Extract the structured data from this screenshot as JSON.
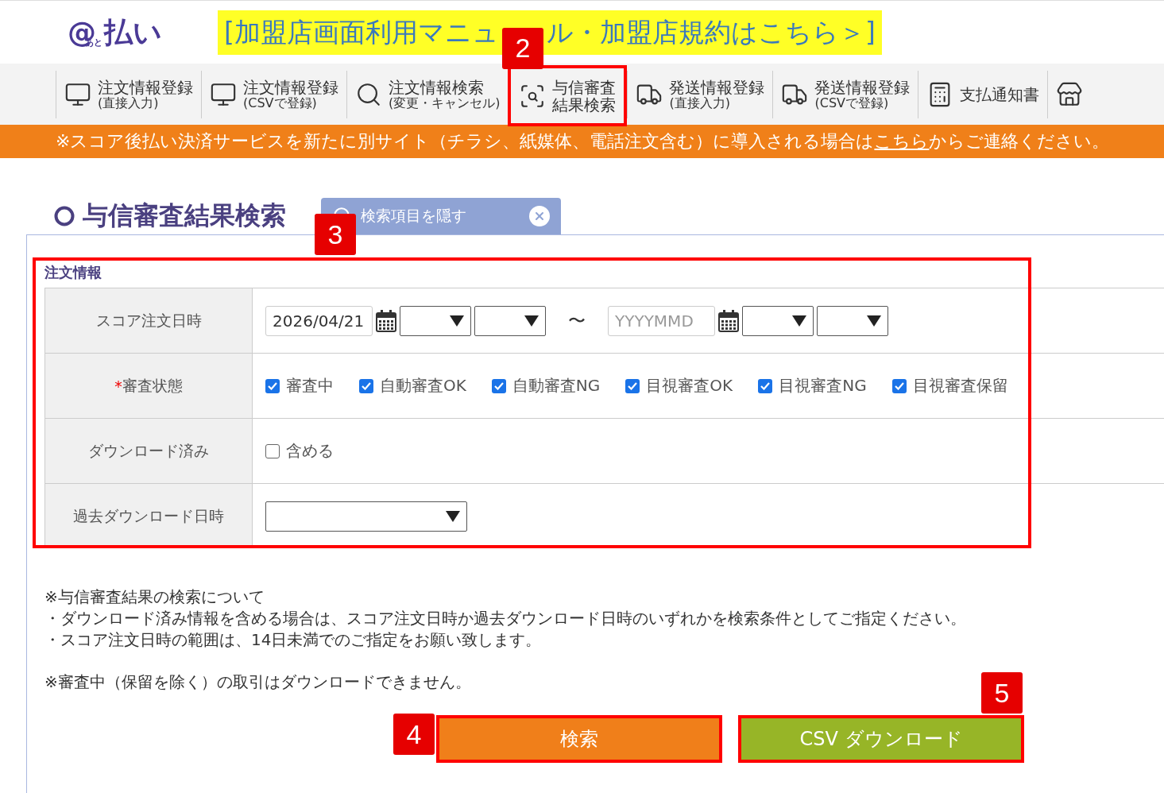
{
  "header": {
    "logo_mark": "@",
    "logo_small": "あと",
    "logo": "払い",
    "banner": [
      "[加盟店画面利用マニュ",
      "ル・加盟店規約はこちら＞]"
    ],
    "badge": "2"
  },
  "nav": [
    {
      "kind": "monitor",
      "label": "注文情報登録",
      "sub": "(直接入力)",
      "highlighted": false
    },
    {
      "kind": "monitor",
      "label": "注文情報登録",
      "sub": "(CSVで登録)",
      "highlighted": false
    },
    {
      "kind": "search",
      "label": "注文情報検索",
      "sub": "(変更・キャンセル)",
      "highlighted": false
    },
    {
      "kind": "scan",
      "label": "与信審査",
      "sub": "結果検索",
      "highlighted": true
    },
    {
      "kind": "truck",
      "label": "発送情報登録",
      "sub": "(直接入力)",
      "highlighted": false
    },
    {
      "kind": "truck",
      "label": "発送情報登録",
      "sub": "(CSVで登録)",
      "highlighted": false
    },
    {
      "kind": "calculator",
      "label": "支払通知書",
      "highlighted": false
    }
  ],
  "notice": {
    "before": "※スコア後払い決済サービスを新たに別サイト（チラシ、紙媒体、電話注文含む）に導入される場合は",
    "link": "こちら",
    "after": "からご連絡ください。"
  },
  "page_title": "与信審査結果検索",
  "toggle_button": "検索項目を隠す",
  "form": {
    "title": "注文情報",
    "badge": "3",
    "highlighted": true,
    "rows": [
      {
        "kind": "daterange",
        "label": "スコア注文日時",
        "from": {
          "value": "2026/04/21"
        },
        "separator": "〜",
        "to": {
          "placeholder": "YYYYMMD"
        }
      },
      {
        "kind": "checks",
        "label": "審査状態",
        "required_mark": "*",
        "options": [
          {
            "label": "審査中",
            "checked": true
          },
          {
            "label": "自動審査OK",
            "checked": true
          },
          {
            "label": "自動審査NG",
            "checked": true
          },
          {
            "label": "目視審査OK",
            "checked": true
          },
          {
            "label": "目視審査NG",
            "checked": true
          },
          {
            "label": "目視審査保留",
            "checked": true
          }
        ]
      },
      {
        "kind": "checks",
        "label": "ダウンロード済み",
        "options": [
          {
            "label": "含める",
            "checked": false
          }
        ]
      },
      {
        "kind": "select",
        "label": "過去ダウンロード日時"
      }
    ]
  },
  "notes": [
    [
      "※与信審査結果の検索について",
      "・ダウンロード済み情報を含める場合は、スコア注文日時か過去ダウンロード日時のいずれかを検索条件としてご指定ください。",
      "・スコア注文日時の範囲は、14日未満でのご指定をお願い致します。"
    ],
    [
      "※審査中（保留を除く）の取引はダウンロードできません。"
    ]
  ],
  "buttons": [
    {
      "kind": "search",
      "label": "検索",
      "highlighted": true,
      "badge": "4"
    },
    {
      "kind": "csv",
      "label": "CSV ダウンロード",
      "highlighted": true,
      "badge": "5"
    }
  ]
}
